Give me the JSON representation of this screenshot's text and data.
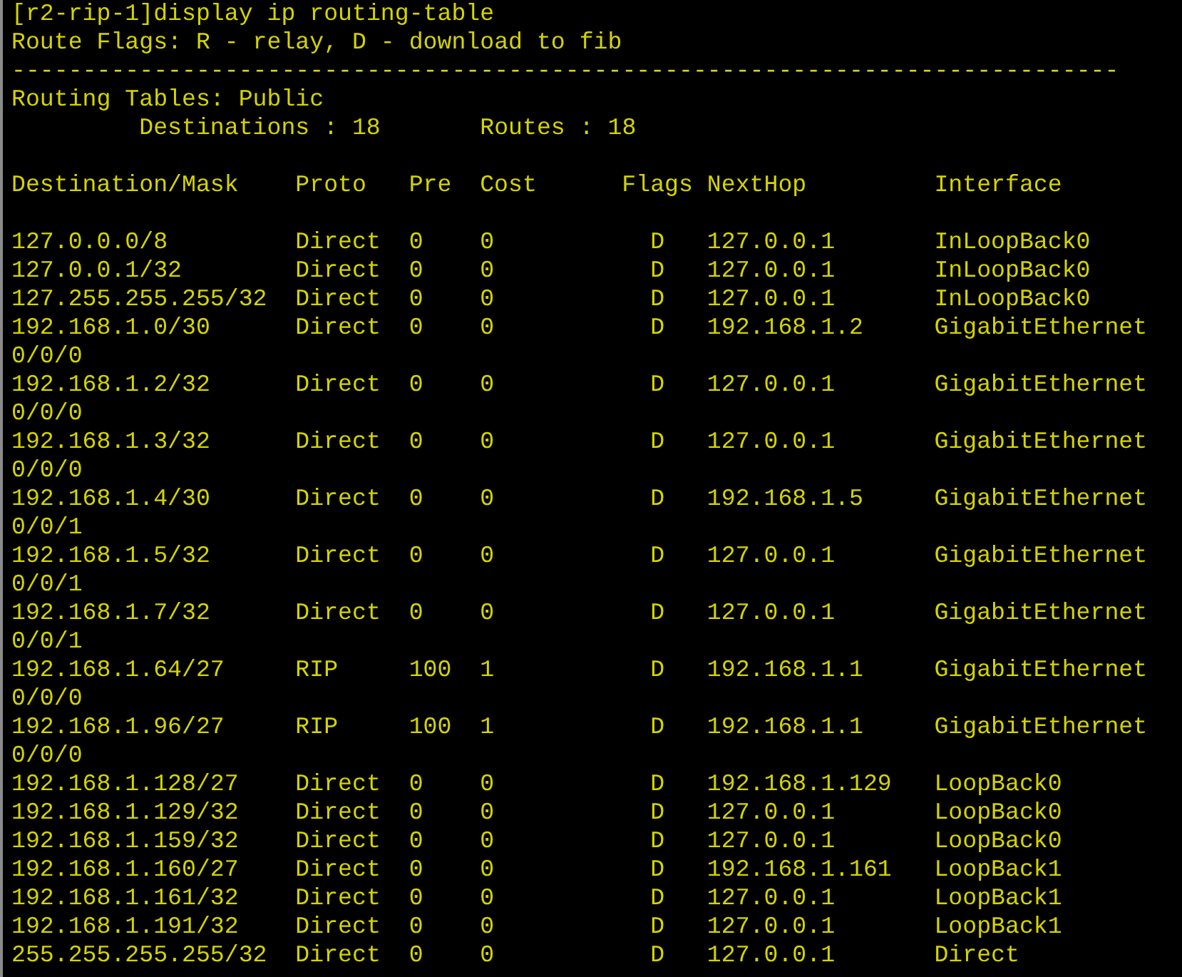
{
  "command": "[r2-rip-1]display ip routing-table",
  "flags_legend": "Route Flags: R - relay, D - download to fib",
  "separator": "------------------------------------------------------------------------------",
  "table_title": "Routing Tables: Public",
  "destinations": "Destinations : 18",
  "routes": "Routes : 18",
  "columns": [
    "Destination/Mask",
    "Proto",
    "Pre",
    "Cost",
    "Flags",
    "NextHop",
    "Interface"
  ],
  "rows": [
    {
      "destination": "127.0.0.0/8",
      "proto": "Direct",
      "pre": "0",
      "cost": "0",
      "flags": "D",
      "nexthop": "127.0.0.1",
      "interface": "InLoopBack0"
    },
    {
      "destination": "127.0.0.1/32",
      "proto": "Direct",
      "pre": "0",
      "cost": "0",
      "flags": "D",
      "nexthop": "127.0.0.1",
      "interface": "InLoopBack0"
    },
    {
      "destination": "127.255.255.255/32",
      "proto": "Direct",
      "pre": "0",
      "cost": "0",
      "flags": "D",
      "nexthop": "127.0.0.1",
      "interface": "InLoopBack0"
    },
    {
      "destination": "192.168.1.0/30",
      "proto": "Direct",
      "pre": "0",
      "cost": "0",
      "flags": "D",
      "nexthop": "192.168.1.2",
      "interface": "GigabitEthernet",
      "interface_continued": "0/0/0"
    },
    {
      "destination": "192.168.1.2/32",
      "proto": "Direct",
      "pre": "0",
      "cost": "0",
      "flags": "D",
      "nexthop": "127.0.0.1",
      "interface": "GigabitEthernet",
      "interface_continued": "0/0/0"
    },
    {
      "destination": "192.168.1.3/32",
      "proto": "Direct",
      "pre": "0",
      "cost": "0",
      "flags": "D",
      "nexthop": "127.0.0.1",
      "interface": "GigabitEthernet",
      "interface_continued": "0/0/0"
    },
    {
      "destination": "192.168.1.4/30",
      "proto": "Direct",
      "pre": "0",
      "cost": "0",
      "flags": "D",
      "nexthop": "192.168.1.5",
      "interface": "GigabitEthernet",
      "interface_continued": "0/0/1"
    },
    {
      "destination": "192.168.1.5/32",
      "proto": "Direct",
      "pre": "0",
      "cost": "0",
      "flags": "D",
      "nexthop": "127.0.0.1",
      "interface": "GigabitEthernet",
      "interface_continued": "0/0/1"
    },
    {
      "destination": "192.168.1.7/32",
      "proto": "Direct",
      "pre": "0",
      "cost": "0",
      "flags": "D",
      "nexthop": "127.0.0.1",
      "interface": "GigabitEthernet",
      "interface_continued": "0/0/1"
    },
    {
      "destination": "192.168.1.64/27",
      "proto": "RIP",
      "pre": "100",
      "cost": "1",
      "flags": "D",
      "nexthop": "192.168.1.1",
      "interface": "GigabitEthernet",
      "interface_continued": "0/0/0"
    },
    {
      "destination": "192.168.1.96/27",
      "proto": "RIP",
      "pre": "100",
      "cost": "1",
      "flags": "D",
      "nexthop": "192.168.1.1",
      "interface": "GigabitEthernet",
      "interface_continued": "0/0/0"
    },
    {
      "destination": "192.168.1.128/27",
      "proto": "Direct",
      "pre": "0",
      "cost": "0",
      "flags": "D",
      "nexthop": "192.168.1.129",
      "interface": "LoopBack0"
    },
    {
      "destination": "192.168.1.129/32",
      "proto": "Direct",
      "pre": "0",
      "cost": "0",
      "flags": "D",
      "nexthop": "127.0.0.1",
      "interface": "LoopBack0"
    },
    {
      "destination": "192.168.1.159/32",
      "proto": "Direct",
      "pre": "0",
      "cost": "0",
      "flags": "D",
      "nexthop": "127.0.0.1",
      "interface": "LoopBack0"
    },
    {
      "destination": "192.168.1.160/27",
      "proto": "Direct",
      "pre": "0",
      "cost": "0",
      "flags": "D",
      "nexthop": "192.168.1.161",
      "interface": "LoopBack1"
    },
    {
      "destination": "192.168.1.161/32",
      "proto": "Direct",
      "pre": "0",
      "cost": "0",
      "flags": "D",
      "nexthop": "127.0.0.1",
      "interface": "LoopBack1"
    },
    {
      "destination": "192.168.1.191/32",
      "proto": "Direct",
      "pre": "0",
      "cost": "0",
      "flags": "D",
      "nexthop": "127.0.0.1",
      "interface": "LoopBack1"
    },
    {
      "destination": "255.255.255.255/32",
      "proto": "Direct",
      "pre": "0",
      "cost": "0",
      "flags": "D",
      "nexthop": "127.0.0.1",
      "interface": "Direct"
    }
  ]
}
